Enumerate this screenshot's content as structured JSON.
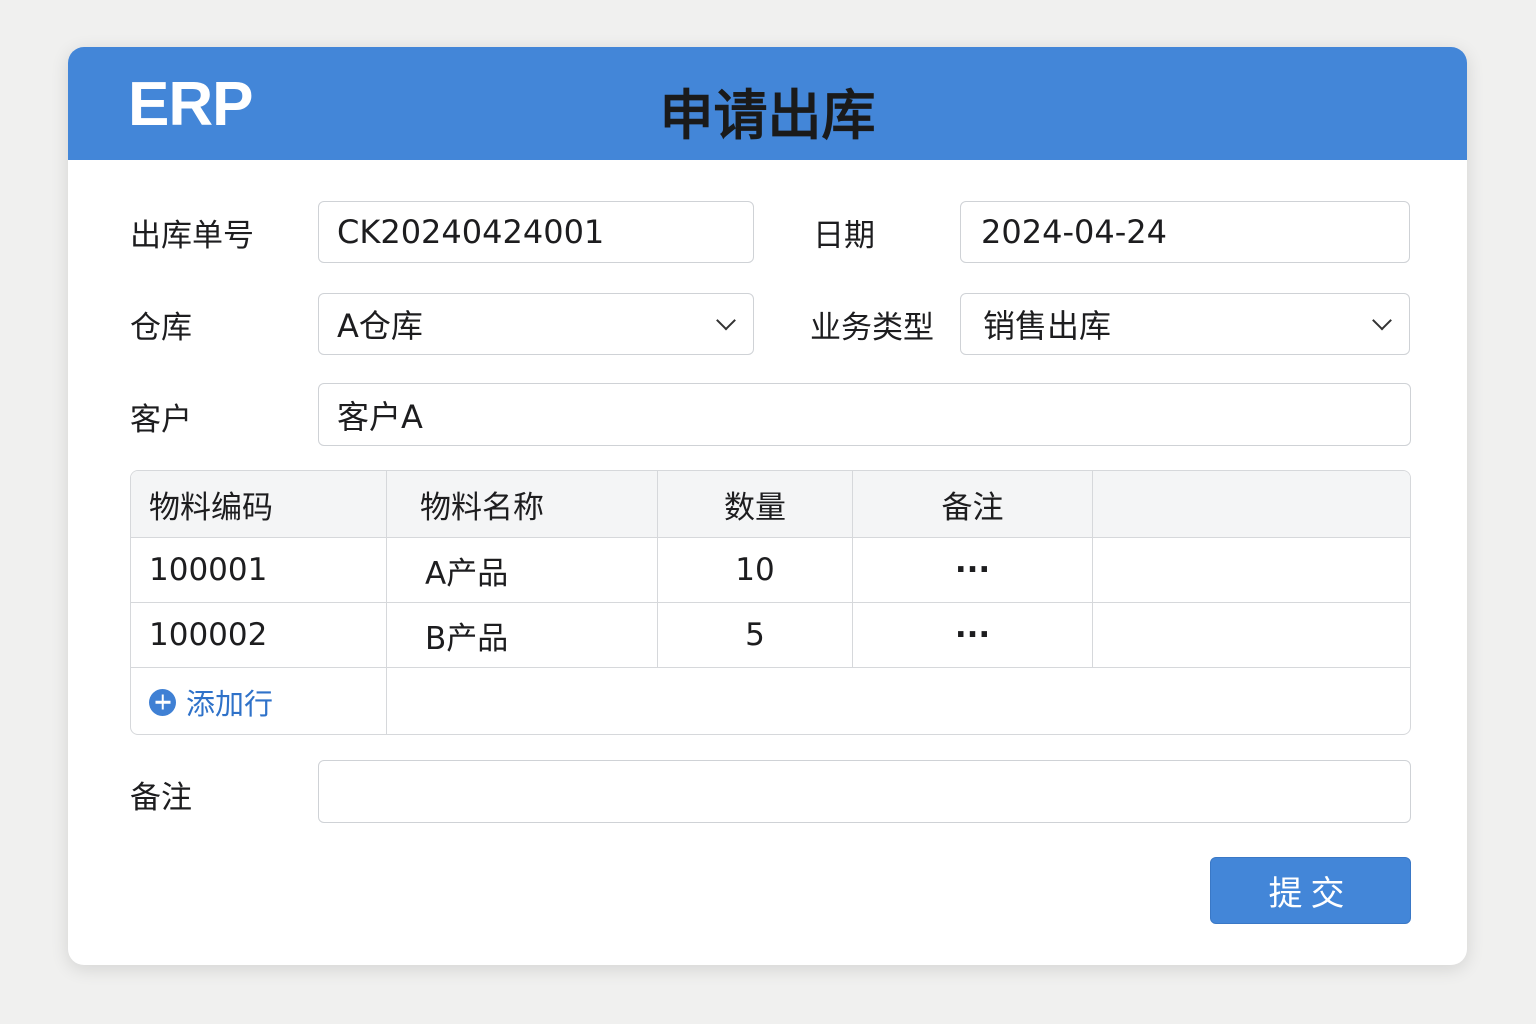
{
  "header": {
    "logo": "ERP",
    "title": "申请出库"
  },
  "form": {
    "order_no": {
      "label": "出库单号",
      "value": "CK20240424001"
    },
    "date": {
      "label": "日期",
      "value": "2024-04-24"
    },
    "warehouse": {
      "label": "仓库",
      "value": "A仓库"
    },
    "biz_type": {
      "label": "业务类型",
      "value": "销售出库"
    },
    "customer": {
      "label": "客户",
      "value": "客户A"
    },
    "remark": {
      "label": "备注",
      "value": ""
    }
  },
  "table": {
    "headers": [
      "物料编码",
      "物料名称",
      "数量",
      "备注"
    ],
    "rows": [
      {
        "code": "100001",
        "name": "A产品",
        "qty": "10",
        "note": "···"
      },
      {
        "code": "100002",
        "name": "B产品",
        "qty": "5",
        "note": "···"
      }
    ],
    "add_row": "添加行"
  },
  "submit": "提交"
}
